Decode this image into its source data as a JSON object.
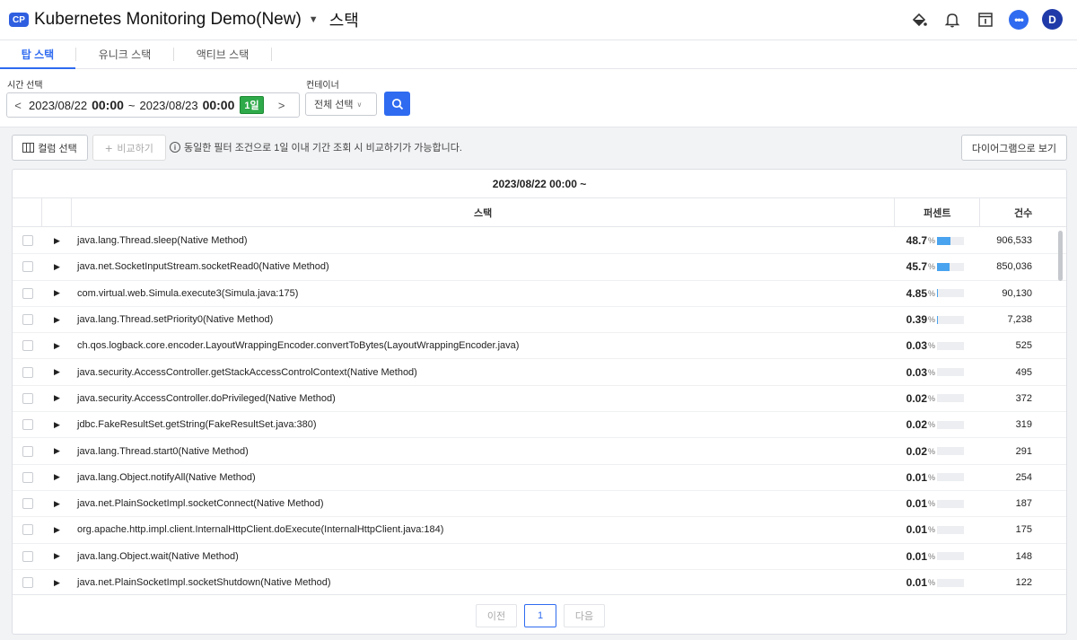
{
  "header": {
    "badge": "CP",
    "project": "Kubernetes Monitoring Demo(New)",
    "page_title": "스택",
    "avatar_initial": "D",
    "chat_label": "•••",
    "icons": [
      "paint-bucket-icon",
      "bell-icon",
      "info-panel-icon",
      "chat-icon"
    ]
  },
  "tabs": [
    {
      "label": "탑 스택",
      "active": true
    },
    {
      "label": "유니크 스택",
      "active": false
    },
    {
      "label": "액티브 스택",
      "active": false
    }
  ],
  "filters": {
    "time_label": "시간 선택",
    "date_from": "2023/08/22",
    "time_from": "00:00",
    "tilde": "~",
    "date_to": "2023/08/23",
    "time_to": "00:00",
    "range_badge": "1일",
    "prev": "<",
    "next": ">",
    "container_label": "컨테이너",
    "container_value": "전체 선택"
  },
  "toolbar": {
    "column_select": "컬럼 선택",
    "compare": "비교하기",
    "info": "동일한 필터 조건으로 1일 이내 기간 조회 시 비교하기가 가능합니다.",
    "diagram": "다이어그램으로 보기"
  },
  "table": {
    "caption": "2023/08/22 00:00 ~",
    "headers": {
      "stack": "스택",
      "percent": "퍼센트",
      "count": "건수"
    },
    "pct_sign": "%",
    "rows": [
      {
        "stack": "java.lang.Thread.sleep(Native Method)",
        "percent": "48.7",
        "fill": 48.7,
        "count": "906,533"
      },
      {
        "stack": "java.net.SocketInputStream.socketRead0(Native Method)",
        "percent": "45.7",
        "fill": 45.7,
        "count": "850,036"
      },
      {
        "stack": "com.virtual.web.Simula.execute3(Simula.java:175)",
        "percent": "4.85",
        "fill": 4.85,
        "count": "90,130"
      },
      {
        "stack": "java.lang.Thread.setPriority0(Native Method)",
        "percent": "0.39",
        "fill": 0.39,
        "count": "7,238"
      },
      {
        "stack": "ch.qos.logback.core.encoder.LayoutWrappingEncoder.convertToBytes(LayoutWrappingEncoder.java)",
        "percent": "0.03",
        "fill": 0.03,
        "count": "525"
      },
      {
        "stack": "java.security.AccessController.getStackAccessControlContext(Native Method)",
        "percent": "0.03",
        "fill": 0.03,
        "count": "495"
      },
      {
        "stack": "java.security.AccessController.doPrivileged(Native Method)",
        "percent": "0.02",
        "fill": 0.02,
        "count": "372"
      },
      {
        "stack": "jdbc.FakeResultSet.getString(FakeResultSet.java:380)",
        "percent": "0.02",
        "fill": 0.02,
        "count": "319"
      },
      {
        "stack": "java.lang.Thread.start0(Native Method)",
        "percent": "0.02",
        "fill": 0.02,
        "count": "291"
      },
      {
        "stack": "java.lang.Object.notifyAll(Native Method)",
        "percent": "0.01",
        "fill": 0.01,
        "count": "254"
      },
      {
        "stack": "java.net.PlainSocketImpl.socketConnect(Native Method)",
        "percent": "0.01",
        "fill": 0.01,
        "count": "187"
      },
      {
        "stack": "org.apache.http.impl.client.InternalHttpClient.doExecute(InternalHttpClient.java:184)",
        "percent": "0.01",
        "fill": 0.01,
        "count": "175"
      },
      {
        "stack": "java.lang.Object.wait(Native Method)",
        "percent": "0.01",
        "fill": 0.01,
        "count": "148"
      },
      {
        "stack": "java.net.PlainSocketImpl.socketShutdown(Native Method)",
        "percent": "0.01",
        "fill": 0.01,
        "count": "122"
      }
    ]
  },
  "pager": {
    "prev": "이전",
    "current": "1",
    "next": "다음"
  },
  "colors": {
    "accent": "#2f6bf0",
    "bar": "#4aa3ef",
    "badge_green": "#2faa4a"
  }
}
